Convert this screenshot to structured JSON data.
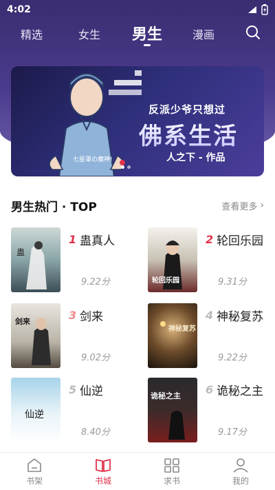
{
  "status_bar": {
    "time": "4:02"
  },
  "nav": {
    "tabs": [
      {
        "label": "精选"
      },
      {
        "label": "女生"
      },
      {
        "label": "男生"
      },
      {
        "label": "漫画"
      }
    ],
    "active": "男生"
  },
  "banner": {
    "subtitle": "反派少爷只想过",
    "title": "佛系生活",
    "author": "人之下 - 作品",
    "side_text": "七星罩の魔神!"
  },
  "section": {
    "title": "男生热门 · TOP",
    "more": "查看更多"
  },
  "books": [
    {
      "rank": "1",
      "title": "蛊真人",
      "score": "9.22分",
      "rank_color": "#e0334b"
    },
    {
      "rank": "2",
      "title": "轮回乐园",
      "score": "9.31分",
      "rank_color": "#e0334b"
    },
    {
      "rank": "3",
      "title": "剑来",
      "score": "9.02分",
      "rank_color": "#f08a8a"
    },
    {
      "rank": "4",
      "title": "神秘复苏",
      "score": "9.22分",
      "rank_color": "#bbbbbb"
    },
    {
      "rank": "5",
      "title": "仙逆",
      "score": "8.40分",
      "rank_color": "#bbbbbb"
    },
    {
      "rank": "6",
      "title": "诡秘之主",
      "score": "9.17分",
      "rank_color": "#bbbbbb"
    }
  ],
  "cover_texts": {
    "book1": "蛊",
    "book2": "轮回乐园",
    "book3": "剑来",
    "book4": "神秘复苏",
    "book5": "仙逆",
    "book6": "诡秘之主"
  },
  "bottom_nav": [
    {
      "label": "书架",
      "icon": "bookshelf-icon"
    },
    {
      "label": "书城",
      "icon": "bookstore-icon"
    },
    {
      "label": "求书",
      "icon": "request-book-icon"
    },
    {
      "label": "我的",
      "icon": "profile-icon"
    }
  ],
  "colors": {
    "accent": "#e0334b",
    "header_bg": "#4b3a8c"
  }
}
